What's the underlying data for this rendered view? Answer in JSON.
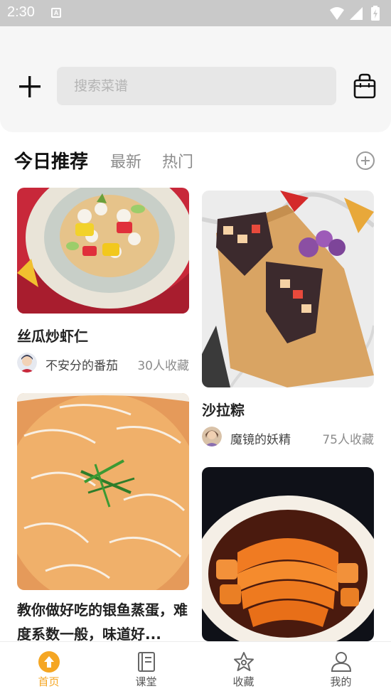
{
  "status_bar": {
    "time": "2:30",
    "notification_glyph": "A",
    "icons": [
      "wifi-icon",
      "signal-icon",
      "battery-charging-icon"
    ]
  },
  "header": {
    "add_icon": "plus-icon",
    "search_placeholder": "搜索菜谱",
    "bag_icon": "shopping-bag-icon"
  },
  "tabs": [
    {
      "label": "今日推荐",
      "active": true
    },
    {
      "label": "最新",
      "active": false
    },
    {
      "label": "热门",
      "active": false
    }
  ],
  "tab_add_icon": "plus-circle-icon",
  "recipes": [
    {
      "title": "丝瓜炒虾仁",
      "author": "不安分的番茄",
      "favorites": "30人收藏"
    },
    {
      "title": "沙拉粽",
      "author": "魔镜的妖精",
      "favorites": "75人收藏"
    },
    {
      "title": "教你做好吃的银鱼蒸蛋，难度系数一般，味道好..."
    },
    {
      "title": ""
    }
  ],
  "bottom_nav": [
    {
      "label": "首页",
      "icon": "home-arrow-icon",
      "active": true
    },
    {
      "label": "课堂",
      "icon": "book-icon",
      "active": false
    },
    {
      "label": "收藏",
      "icon": "star-icon",
      "active": false
    },
    {
      "label": "我的",
      "icon": "user-icon",
      "active": false
    }
  ],
  "colors": {
    "accent": "#f5a623",
    "status_bar": "#c9c9c9",
    "header_bg": "#f6f6f6",
    "search_bg": "#e7e7e7"
  }
}
